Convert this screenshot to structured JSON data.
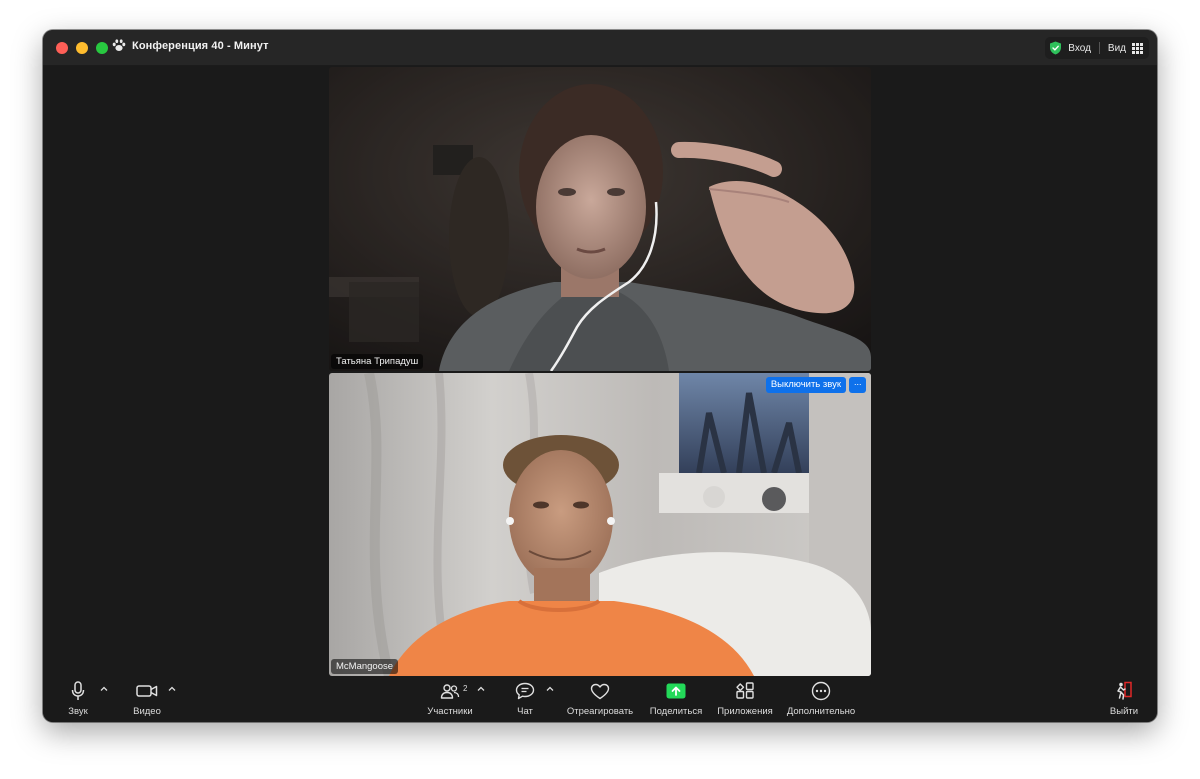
{
  "window": {
    "title": "Конференция  40 - Минут",
    "login_label": "Вход",
    "view_label": "Вид"
  },
  "participants_tiles": [
    {
      "name": "Татьяна Трипадуш"
    },
    {
      "name": "McMangoose",
      "mute_label": "Выключить звук",
      "more_label": "···"
    }
  ],
  "toolbar": {
    "audio": {
      "label": "Звук",
      "icon": "microphone-icon"
    },
    "video": {
      "label": "Видео",
      "icon": "video-camera-icon"
    },
    "participants": {
      "label": "Участники",
      "count": "2",
      "icon": "participants-icon"
    },
    "chat": {
      "label": "Чат",
      "icon": "chat-icon"
    },
    "react": {
      "label": "Отреагировать",
      "icon": "heart-icon"
    },
    "share": {
      "label": "Поделиться",
      "icon": "share-screen-icon"
    },
    "apps": {
      "label": "Приложения",
      "icon": "apps-icon"
    },
    "more": {
      "label": "Дополнительно",
      "icon": "more-icon"
    },
    "leave": {
      "label": "Выйти",
      "icon": "leave-icon"
    }
  },
  "colors": {
    "accent_blue": "#0e71eb",
    "share_green": "#23d959",
    "shield_green": "#2ec05b",
    "leave_red": "#e02828"
  }
}
